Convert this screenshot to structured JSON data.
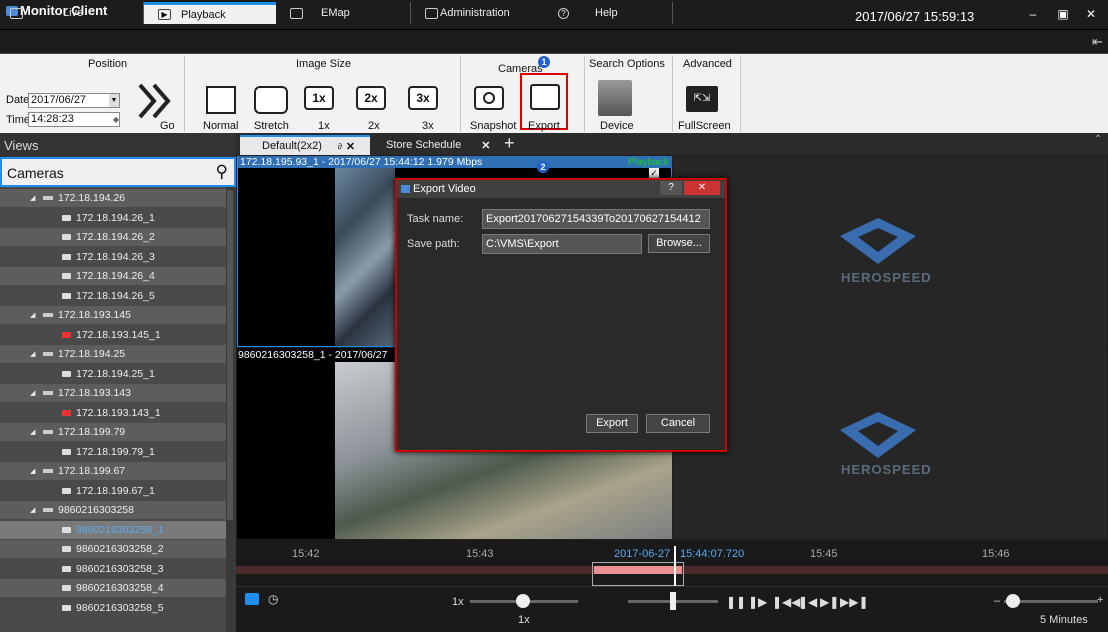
{
  "app": {
    "title": "Monitor Client",
    "clock": "2017/06/27 15:59:13"
  },
  "tabs": [
    {
      "label": "Live"
    },
    {
      "label": "Playback"
    },
    {
      "label": "EMap"
    },
    {
      "label": "Administration"
    },
    {
      "label": "Help"
    }
  ],
  "ribbon": {
    "position": {
      "title": "Position",
      "date_label": "Date",
      "date_value": "2017/06/27",
      "time_label": "Time",
      "time_value": "14:28:23",
      "go_label": "Go"
    },
    "image_size": {
      "title": "Image Size",
      "buttons": [
        "Normal",
        "Stretch",
        "1x",
        "2x",
        "3x"
      ]
    },
    "cameras": {
      "title": "Cameras",
      "snapshot": "Snapshot",
      "export": "Export"
    },
    "search": {
      "title": "Search Options",
      "device": "Device"
    },
    "advanced": {
      "title": "Advanced",
      "fullscreen": "FullScreen"
    }
  },
  "views": {
    "title": "Views",
    "cameras_label": "Cameras",
    "tabs": [
      "Default(2x2)",
      "Store Schedule"
    ]
  },
  "tree": [
    {
      "label": "172.18.194.26",
      "type": "device"
    },
    {
      "label": "172.18.194.26_1",
      "type": "cam"
    },
    {
      "label": "172.18.194.26_2",
      "type": "cam"
    },
    {
      "label": "172.18.194.26_3",
      "type": "cam"
    },
    {
      "label": "172.18.194.26_4",
      "type": "cam"
    },
    {
      "label": "172.18.194.26_5",
      "type": "cam"
    },
    {
      "label": "172.18.193.145",
      "type": "device"
    },
    {
      "label": "172.18.193.145_1",
      "type": "camx"
    },
    {
      "label": "172.18.194.25",
      "type": "device"
    },
    {
      "label": "172.18.194.25_1",
      "type": "cam"
    },
    {
      "label": "172.18.193.143",
      "type": "device"
    },
    {
      "label": "172.18.193.143_1",
      "type": "camx"
    },
    {
      "label": "172.18.199.79",
      "type": "device"
    },
    {
      "label": "172.18.199.79_1",
      "type": "cam"
    },
    {
      "label": "172.18.199.67",
      "type": "device"
    },
    {
      "label": "172.18.199.67_1",
      "type": "cam"
    },
    {
      "label": "9860216303258",
      "type": "device"
    },
    {
      "label": "9860216303258_1",
      "type": "cam"
    },
    {
      "label": "9860216303258_2",
      "type": "cam"
    },
    {
      "label": "9860216303258_3",
      "type": "cam"
    },
    {
      "label": "9860216303258_4",
      "type": "cam"
    },
    {
      "label": "9860216303258_5",
      "type": "cam"
    }
  ],
  "video": {
    "cell1_caption": "172.18.195.93_1 - 2017/06/27 15:44:12 1.979 Mbps",
    "cell1_status": "Playback",
    "cell3_caption": "9860216303258_1 - 2017/06/27",
    "logo_text": "HEROSPEED"
  },
  "dialog": {
    "title": "Export Video",
    "task_label": "Task name:",
    "task_value": "Export20170627154339To20170627154412",
    "path_label": "Save path:",
    "path_value": "C:\\VMS\\Export",
    "browse": "Browse...",
    "export": "Export",
    "cancel": "Cancel"
  },
  "timeline": {
    "ticks": [
      "15:42",
      "15:43",
      "15:45",
      "15:46"
    ],
    "cursor_date": "2017-06-27",
    "cursor_time": "15:44:07.720"
  },
  "controls": {
    "speed": "1x",
    "speed_bottom": "1x",
    "zoom": "5 Minutes"
  },
  "badges": {
    "one": "1",
    "two": "2"
  },
  "colors": {
    "accent": "#1f8ef1",
    "highlight": "#cc0000",
    "titlebar": "#1c1c1c"
  }
}
